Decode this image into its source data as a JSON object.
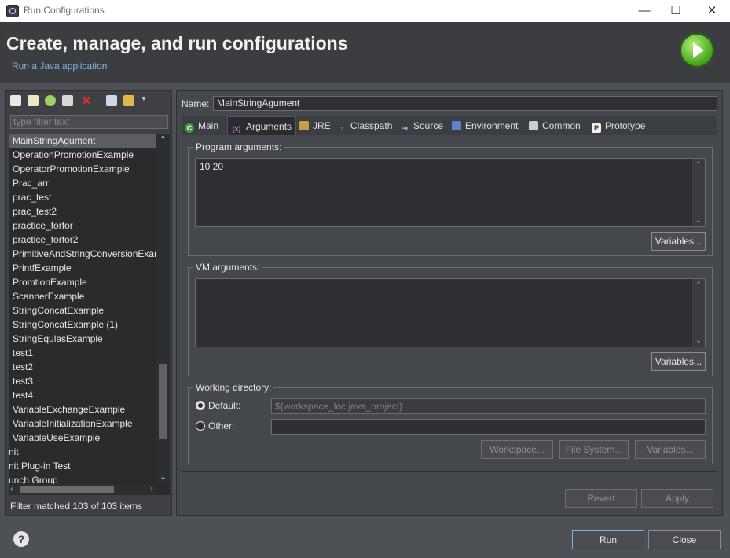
{
  "window": {
    "title": "Run Configurations",
    "controls": {
      "minimize": "—",
      "maximize": "☐",
      "close": "✕"
    }
  },
  "header": {
    "title": "Create, manage, and run configurations",
    "subtitle": "Run a Java application"
  },
  "left": {
    "filter_placeholder": "type filter text",
    "items": [
      "MainStringAgument",
      "OperationPromotionExample",
      "OperatorPromotionExample",
      "Prac_arr",
      "prac_test",
      "prac_test2",
      "practice_forfor",
      "practice_forfor2",
      "PrimitiveAndStringConversionExam",
      "PrintfExample",
      "PromtionExample",
      "ScannerExample",
      "StringConcatExample",
      "StringConcatExample (1)",
      "StringEqulasExample",
      "test1",
      "test2",
      "test3",
      "test4",
      "VariableExchangeExample",
      "VariableInitializationExample",
      "VariableUseExample",
      "nit",
      "nit Plug-in Test",
      "unch Group"
    ],
    "status": "Filter matched 103 of 103 items"
  },
  "right": {
    "name_label": "Name:",
    "name_value": "MainStringAgument",
    "tabs": [
      "Main",
      "Arguments",
      "JRE",
      "Classpath",
      "Source",
      "Environment",
      "Common",
      "Prototype"
    ],
    "program_args": {
      "label": "Program arguments:",
      "value": "10 20",
      "variables": "Variables..."
    },
    "vm_args": {
      "label": "VM arguments:",
      "value": "",
      "variables": "Variables..."
    },
    "working_dir": {
      "label": "Working directory:",
      "default_label": "Default:",
      "default_value": "${workspace_loc:java_project}",
      "other_label": "Other:",
      "buttons": [
        "Workspace...",
        "File System...",
        "Variables..."
      ]
    },
    "revert": "Revert",
    "apply": "Apply"
  },
  "footer": {
    "help": "?",
    "run": "Run",
    "close": "Close"
  }
}
